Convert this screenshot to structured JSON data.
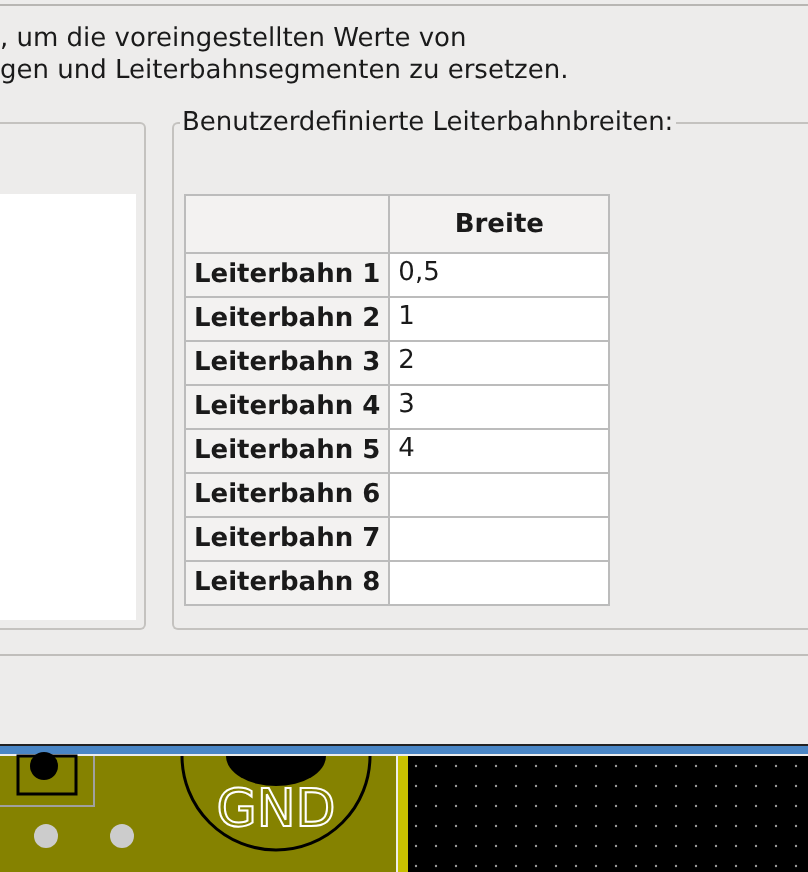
{
  "description_lines": [
    ", um die voreingestellten Werte von",
    "gen und Leiterbahnsegmenten zu ersetzen."
  ],
  "custom_track_widths": {
    "title": "Benutzerdefinierte Leiterbahnbreiten:",
    "columns": [
      "Breite"
    ],
    "rows": [
      {
        "label": "Leiterbahn 1",
        "value": "0,5"
      },
      {
        "label": "Leiterbahn 2",
        "value": "1"
      },
      {
        "label": "Leiterbahn 3",
        "value": "2"
      },
      {
        "label": "Leiterbahn 4",
        "value": "3"
      },
      {
        "label": "Leiterbahn 5",
        "value": "4"
      },
      {
        "label": "Leiterbahn 6",
        "value": ""
      },
      {
        "label": "Leiterbahn 7",
        "value": ""
      },
      {
        "label": "Leiterbahn 8",
        "value": ""
      }
    ]
  },
  "pcb_view": {
    "pad_label": "GND"
  }
}
